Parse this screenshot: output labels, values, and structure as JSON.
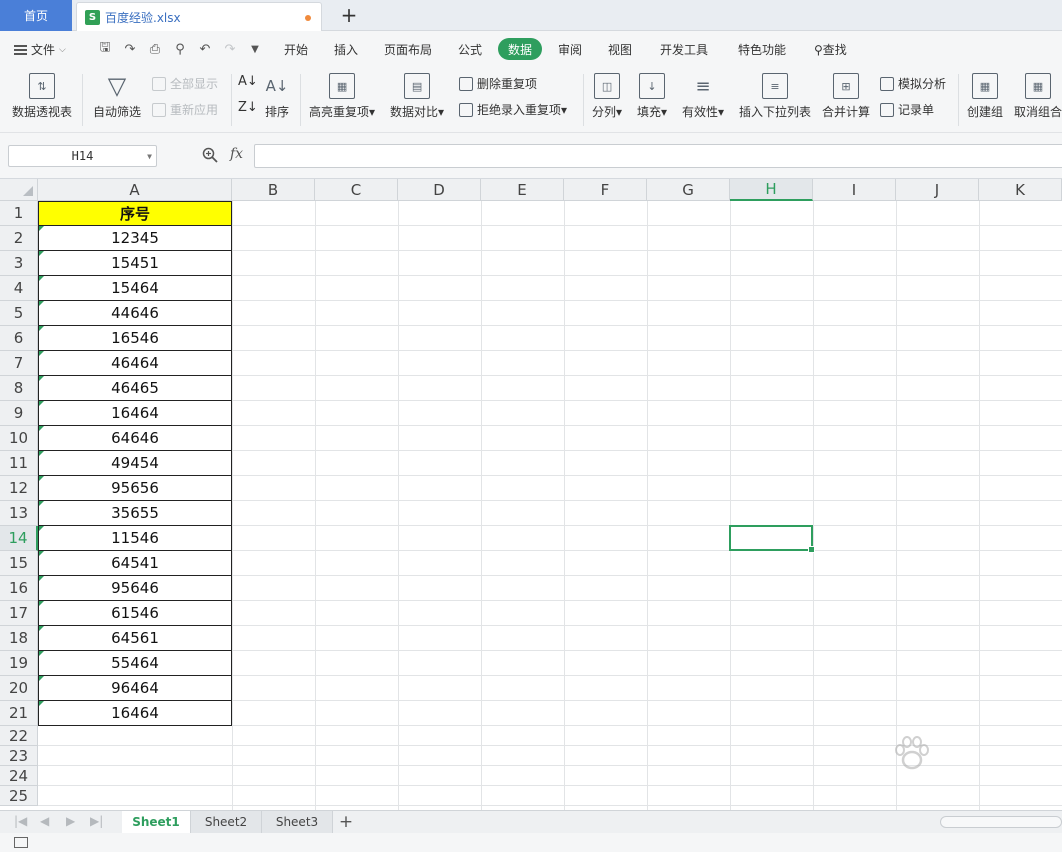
{
  "tabs": {
    "home": "首页",
    "file": "百度经验.xlsx",
    "add": "+"
  },
  "menu": {
    "file": "文件",
    "items": [
      "开始",
      "插入",
      "页面布局",
      "公式",
      "数据",
      "审阅",
      "视图",
      "开发工具",
      "特色功能",
      "查找"
    ],
    "active": "数据"
  },
  "ribbon": {
    "pivot": "数据透视表",
    "autofilter": "自动筛选",
    "show_all": "全部显示",
    "reapply": "重新应用",
    "sort": "排序",
    "highlight_dup": "高亮重复项",
    "compare": "数据对比",
    "delete_dup": "删除重复项",
    "reject_dup": "拒绝录入重复项",
    "split": "分列",
    "fill": "填充",
    "validity": "有效性",
    "insert_dropdown": "插入下拉列表",
    "merge_calc": "合并计算",
    "what_if": "模拟分析",
    "record_form": "记录单",
    "group": "创建组",
    "ungroup": "取消组合"
  },
  "formula": {
    "cell_ref": "H14",
    "fx": "fx",
    "value": ""
  },
  "grid": {
    "columns": [
      "A",
      "B",
      "C",
      "D",
      "E",
      "F",
      "G",
      "H",
      "I",
      "J",
      "K"
    ],
    "active_column": "H",
    "active_row": 14,
    "rows": [
      "1",
      "2",
      "3",
      "4",
      "5",
      "6",
      "7",
      "8",
      "9",
      "10",
      "11",
      "12",
      "13",
      "14",
      "15",
      "16",
      "17",
      "18",
      "19",
      "20",
      "21",
      "22",
      "23",
      "24",
      "25"
    ],
    "colA_header": "序号",
    "colA_values": [
      "12345",
      "15451",
      "15464",
      "44646",
      "16546",
      "46464",
      "46465",
      "16464",
      "64646",
      "49454",
      "95656",
      "35655",
      "11546",
      "64541",
      "95646",
      "61546",
      "64561",
      "55464",
      "96464",
      "16464"
    ]
  },
  "sheets": {
    "tabs": [
      "Sheet1",
      "Sheet2",
      "Sheet3"
    ],
    "active": "Sheet1"
  },
  "colors": {
    "accent": "#2e9e5e",
    "header_fill": "#ffff00",
    "home_tab": "#4a7fd8"
  }
}
